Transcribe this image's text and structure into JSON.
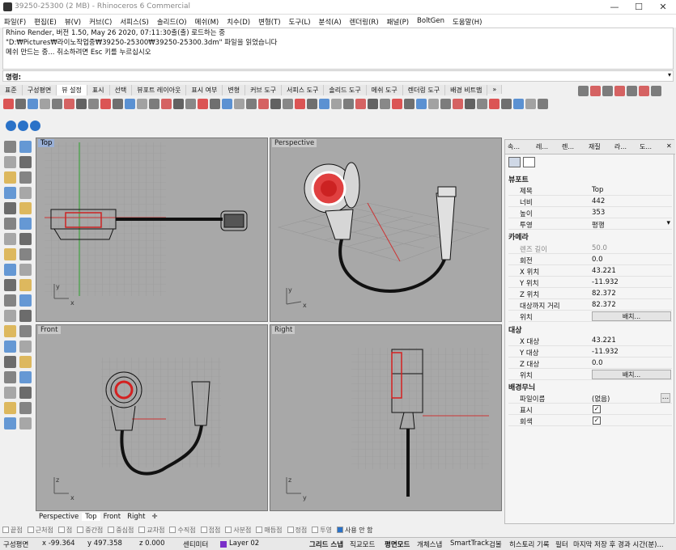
{
  "window": {
    "title": "39250-25300 (2 MB) - Rhinoceros 6 Commercial"
  },
  "menu": [
    "파일(F)",
    "편집(E)",
    "뷰(V)",
    "커브(C)",
    "서피스(S)",
    "솔리드(O)",
    "메쉬(M)",
    "치수(D)",
    "변형(T)",
    "도구(L)",
    "분석(A)",
    "렌더링(R)",
    "패널(P)",
    "BoltGen",
    "도움말(H)"
  ],
  "history": [
    "Rhino Render, 버전 1.50, May 26 2020, 07:11:30출(출) 로드하는 중",
    "\"D:₩Pictures₩라이노작업중₩39250-25300₩39250-25300.3dm\" 파일을 읽었습니다",
    "메쉬 만드는 중... 취소하려면 Esc 키를 누르십시오"
  ],
  "command": {
    "label": "명령:",
    "value": ""
  },
  "toolbar_tabs": [
    "표준",
    "구성평면",
    "뷰 설정",
    "표시",
    "선택",
    "뷰포트 레이아웃",
    "표시 여부",
    "변형",
    "커브 도구",
    "서피스 도구",
    "솔리드 도구",
    "메쉬 도구",
    "렌더링 도구",
    "배경 비트맵"
  ],
  "active_tab": "뷰 설정",
  "viewports": {
    "top": "Top",
    "perspective": "Perspective",
    "front": "Front",
    "right": "Right"
  },
  "viewport_tabs": [
    "Perspective",
    "Top",
    "Front",
    "Right"
  ],
  "panel_tabs": [
    "속...",
    "레...",
    "렌...",
    "재질",
    "라...",
    "도..."
  ],
  "panel": {
    "viewport_section": "뷰포트",
    "title_k": "제목",
    "title_v": "Top",
    "width_k": "너비",
    "width_v": "442",
    "height_k": "높이",
    "height_v": "353",
    "proj_k": "투영",
    "proj_v": "평행",
    "camera_section": "카메라",
    "lens_k": "렌즈 길이",
    "lens_v": "50.0",
    "rot_k": "회전",
    "rot_v": "0.0",
    "x_k": "X 위치",
    "x_v": "43.221",
    "y_k": "Y 위치",
    "y_v": "-11.932",
    "z_k": "Z 위치",
    "z_v": "82.372",
    "dist_k": "대상까지 거리",
    "dist_v": "82.372",
    "pos_k": "위치",
    "place_btn": "배치...",
    "target_section": "대상",
    "tx_k": "X 대상",
    "tx_v": "43.221",
    "ty_k": "Y 대상",
    "ty_v": "-11.932",
    "tz_k": "Z 대상",
    "tz_v": "0.0",
    "tpos_k": "위치",
    "tplace_btn": "배치...",
    "bg_section": "배경무늬",
    "file_k": "파일이름",
    "file_v": "(없음)",
    "file_btn": "...",
    "show_k": "표시",
    "gray_k": "회색"
  },
  "osnap": [
    "끝점",
    "근처점",
    "점",
    "중간점",
    "중심점",
    "교차점",
    "수직점",
    "접점",
    "사분점",
    "매듭점",
    "정점",
    "투영"
  ],
  "osnap_disable": "사용 안 함",
  "status": {
    "cplane": "구성평면",
    "x": "x -99.364",
    "y": "y 497.358",
    "z": "z 0.000",
    "unit": "센티미터",
    "layer": "Layer 02",
    "grid": "그리드 스냅",
    "ortho": "직교모드",
    "planar": "평면모드",
    "osnap": "개체스냅",
    "smart": "SmartTrack",
    "gumball": "검볼",
    "history": "히스토리 기록",
    "filter": "필터",
    "save": "마지막 저장 후 경과 시간(분)..."
  },
  "colors": {
    "accent": "#d42020",
    "active_label": "#9ab0d6",
    "layer": "#7a2fc9"
  }
}
